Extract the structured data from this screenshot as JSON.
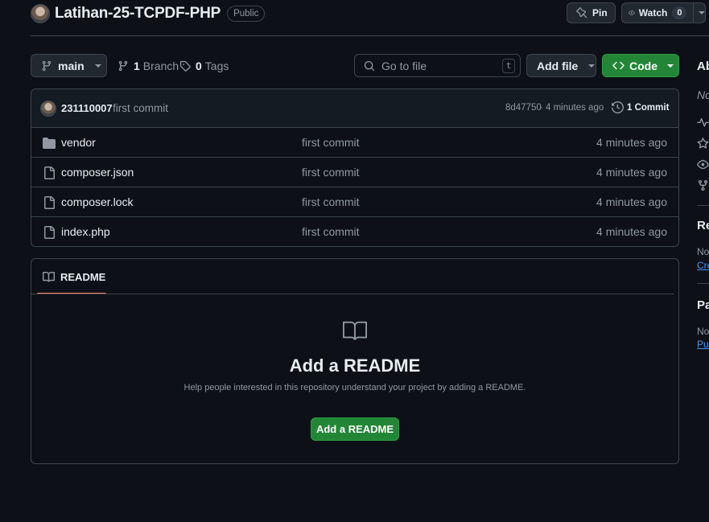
{
  "header": {
    "repo_name": "Latihan-25-TCPDF-PHP",
    "visibility": "Public",
    "pin_label": "Pin",
    "watch_label": "Watch",
    "watch_count": "0"
  },
  "toolbar": {
    "branch": "main",
    "branch_count": "1",
    "branch_label": "Branch",
    "tag_count": "0",
    "tag_label": "Tags",
    "search_placeholder": "Go to file",
    "search_shortcut": "t",
    "add_file_label": "Add file",
    "code_label": "Code"
  },
  "commit": {
    "author": "231110007",
    "message": "first commit",
    "hash": "8d47750",
    "time": "4 minutes ago",
    "separator": "·",
    "count_label": "1 Commit"
  },
  "files": [
    {
      "name": "vendor",
      "type": "folder",
      "message": "first commit",
      "time": "4 minutes ago"
    },
    {
      "name": "composer.json",
      "type": "file",
      "message": "first commit",
      "time": "4 minutes ago"
    },
    {
      "name": "composer.lock",
      "type": "file",
      "message": "first commit",
      "time": "4 minutes ago"
    },
    {
      "name": "index.php",
      "type": "file",
      "message": "first commit",
      "time": "4 minutes ago"
    }
  ],
  "readme": {
    "tab_label": "README",
    "heading": "Add a README",
    "description": "Help people interested in this repository understand your project by adding a README.",
    "button_label": "Add a README"
  },
  "sidebar": {
    "about_heading": "Ab",
    "about_desc": "No",
    "releases_heading": "Re",
    "releases_text": "No",
    "releases_link": "Cre",
    "packages_heading": "Pa",
    "packages_text": "No",
    "packages_link": "Pub"
  },
  "colors": {
    "background": "#0d1117",
    "border": "#3d444d",
    "primary_green": "#238636",
    "link_blue": "#4493f8",
    "tab_underline": "#f78166"
  }
}
